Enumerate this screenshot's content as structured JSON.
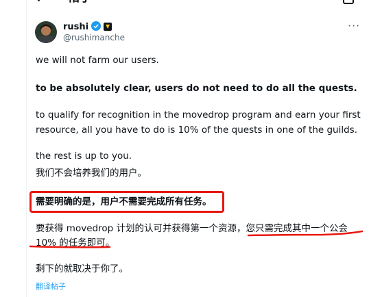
{
  "topbar": {
    "back_icon": "arrow-left-icon",
    "title": "帖子"
  },
  "author": {
    "name": "rushi",
    "handle": "@rushimanche",
    "verified": true,
    "affiliate_badge": "affiliate-badge-icon"
  },
  "post": {
    "para1": "we will not farm our users.",
    "para2": "to be absolutely clear, users do not need to do all the quests.",
    "para3_line1": "to qualify for recognition in the movedrop program and earn your first",
    "para3_line2": "resource, all you have to do is 10% of the quests in one of the guilds.",
    "para4": "the rest is up to you."
  },
  "translation": {
    "line1": "我们不会培养我们的用户。",
    "line2": "需要明确的是，用户不需要完成所有任务。",
    "line3a": "要获得 movedrop 计划的认可并获得第一个资源，您只需完成其中一个公会",
    "line3b": "10% 的任务即可。",
    "line4": "剩下的就取决于你了。"
  },
  "translate_link": "翻译帖子",
  "colors": {
    "accent": "#1d9bf0",
    "highlight": "#e8170f",
    "muted": "#536471"
  }
}
